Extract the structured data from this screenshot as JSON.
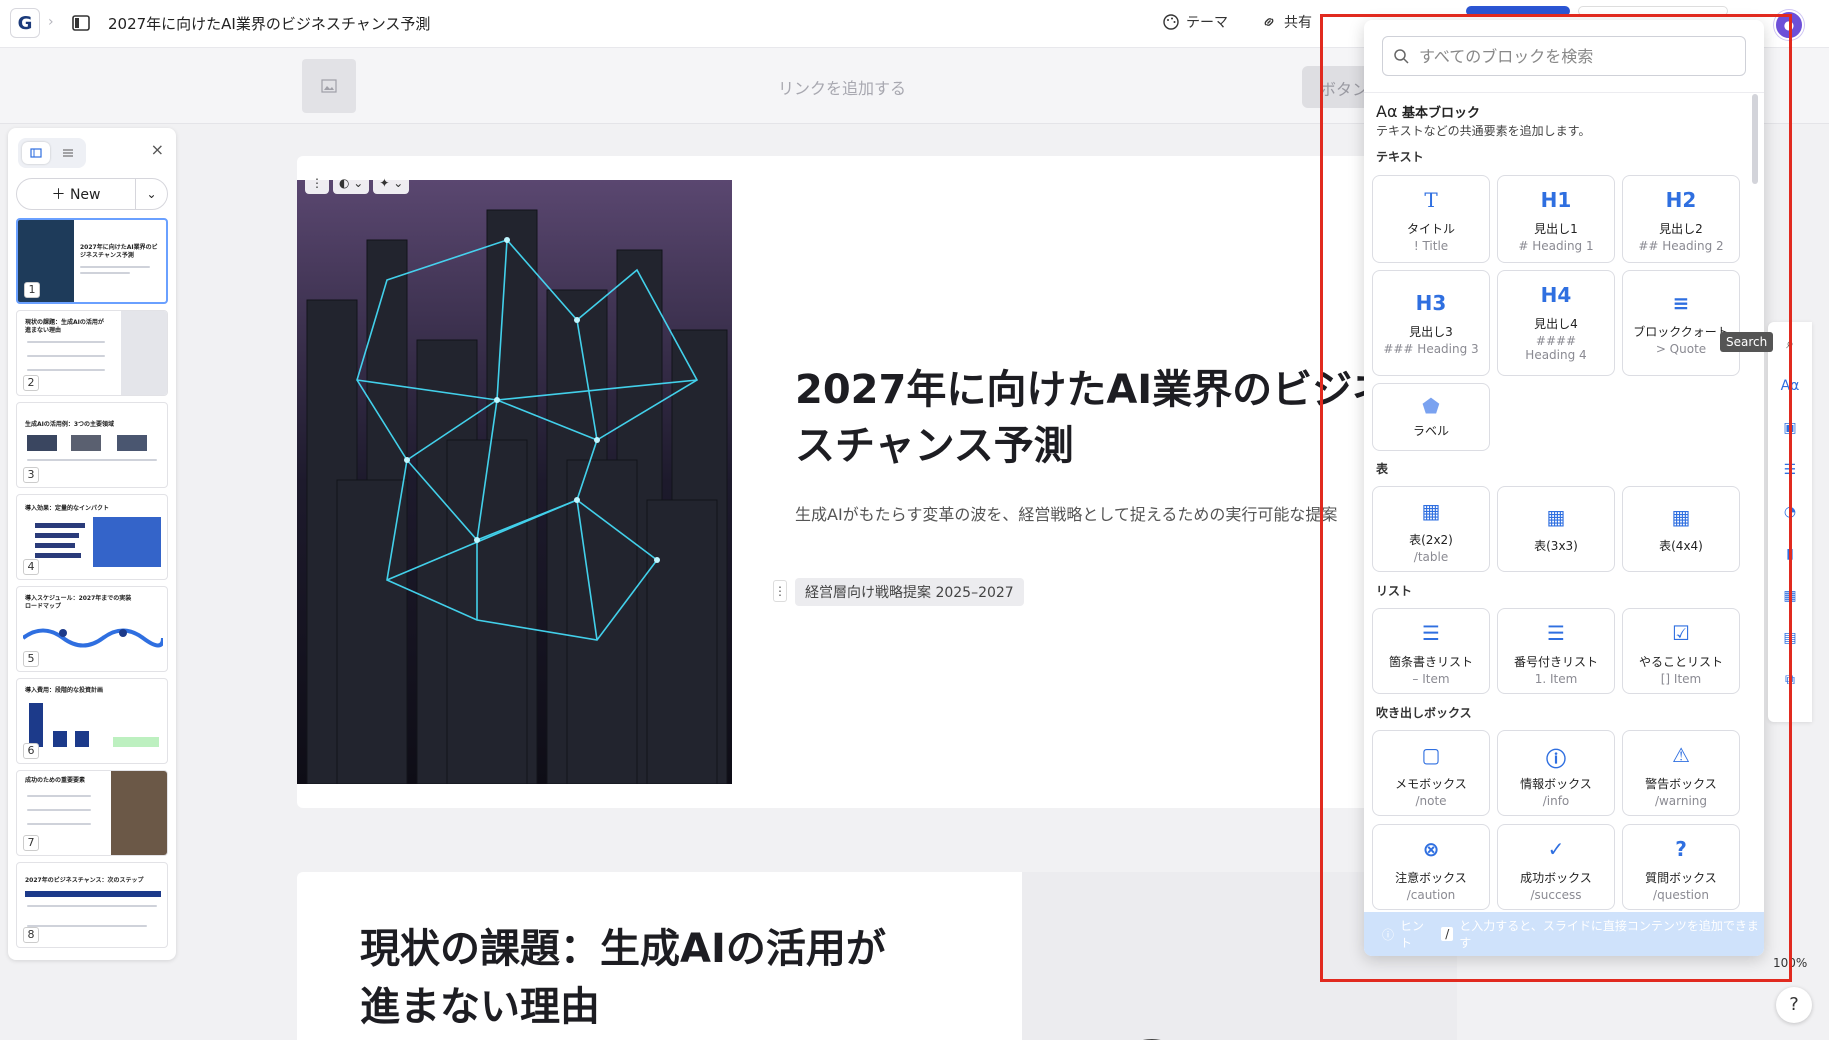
{
  "header": {
    "logo": "G",
    "breadcrumb_sep": "›",
    "title": "2027年に向けたAI業界のビジネスチャンス予測",
    "theme_label": "テーマ",
    "share_label": "共有"
  },
  "linkbar": {
    "add_link": "リンクを追加する",
    "button_label": "ボタン"
  },
  "sidebar": {
    "close": "×",
    "new_label": "New",
    "thumbnails": [
      {
        "num": "1",
        "title": "2027年に向けたAI業界のビジネスチャンス予測"
      },
      {
        "num": "2",
        "title": "現状の課題：生成AIの活用が進まない理由"
      },
      {
        "num": "3",
        "title": "生成AIの活用例：3つの主要領域"
      },
      {
        "num": "4",
        "title": "導入効果：定量的なインパクト"
      },
      {
        "num": "5",
        "title": "導入スケジュール：2027年までの実装ロードマップ"
      },
      {
        "num": "6",
        "title": "導入費用：段階的な投資計画"
      },
      {
        "num": "7",
        "title": "成功のための重要要素"
      },
      {
        "num": "8",
        "title": "2027年のビジネスチャンス：次のステップ"
      }
    ]
  },
  "slide1": {
    "title": "2027年に向けたAI業界のビジネスチャンス予測",
    "subtitle": "生成AIがもたらす変革の波を、経営戦略として捉えるための実行可能な提案",
    "tag": "経営層向け戦略提案 2025–2027"
  },
  "slide2": {
    "title_line1": "現状の課題：生成AIの活用が",
    "title_line2": "進まない理由"
  },
  "picker": {
    "search_placeholder": "すべてのブロックを検索",
    "basic_title": "基本ブロック",
    "basic_desc": "テキストなどの共通要素を追加します。",
    "sections": {
      "text": "テキスト",
      "table": "表",
      "list": "リスト",
      "callout": "吹き出しボックス"
    },
    "text_blocks": [
      {
        "icon": "T",
        "name": "タイトル",
        "code": "! Title"
      },
      {
        "icon": "H1",
        "name": "見出し1",
        "code": "# Heading 1"
      },
      {
        "icon": "H2",
        "name": "見出し2",
        "code": "## Heading 2"
      },
      {
        "icon": "H3",
        "name": "見出し3",
        "code": "### Heading 3"
      },
      {
        "icon": "H4",
        "name": "見出し4",
        "code": "#### Heading 4"
      },
      {
        "icon": "≡",
        "name": "ブロッククォート",
        "code": "> Quote"
      },
      {
        "icon": "⬟",
        "name": "ラベル",
        "code": ""
      }
    ],
    "table_blocks": [
      {
        "icon": "▦",
        "name": "表(2x2)",
        "code": "/table"
      },
      {
        "icon": "▦",
        "name": "表(3x3)",
        "code": ""
      },
      {
        "icon": "▦",
        "name": "表(4x4)",
        "code": ""
      }
    ],
    "list_blocks": [
      {
        "icon": "☰",
        "name": "箇条書きリスト",
        "code": "– Item"
      },
      {
        "icon": "☰",
        "name": "番号付きリスト",
        "code": "1. Item"
      },
      {
        "icon": "☑",
        "name": "やることリスト",
        "code": "[] Item"
      }
    ],
    "callout_blocks": [
      {
        "icon": "▢",
        "name": "メモボックス",
        "code": "/note"
      },
      {
        "icon": "ⓘ",
        "name": "情報ボックス",
        "code": "/info"
      },
      {
        "icon": "⚠",
        "name": "警告ボックス",
        "code": "/warning"
      },
      {
        "icon": "⊗",
        "name": "注意ボックス",
        "code": "/caution"
      },
      {
        "icon": "✓",
        "name": "成功ボックス",
        "code": "/success"
      },
      {
        "icon": "?",
        "name": "質問ボックス",
        "code": "/question"
      }
    ],
    "hint_prefix": "ヒント",
    "hint_slash": "/",
    "hint_suffix": "と入力すると、スライドに直接コンテンツを追加できます"
  },
  "rail": {
    "tooltip": "Search",
    "zoom": "100%",
    "help": "?"
  }
}
